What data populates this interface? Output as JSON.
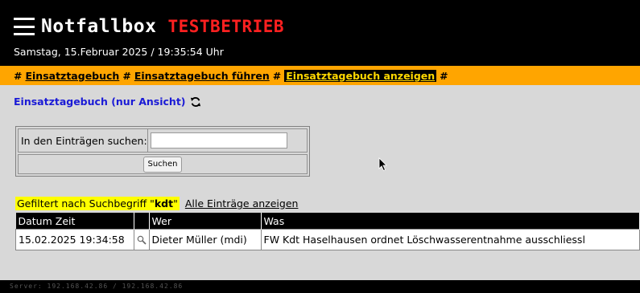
{
  "header": {
    "app_title": "Notfallbox",
    "mode_label": "TESTBETRIEB",
    "datetime": "Samstag, 15.Februar 2025 / 19:35:54 Uhr"
  },
  "breadcrumb": {
    "separator": "#",
    "items": [
      {
        "label": "Einsatztagebuch"
      },
      {
        "label": "Einsatztagebuch führen"
      },
      {
        "label": "Einsatztagebuch anzeigen"
      }
    ]
  },
  "page": {
    "heading": "Einsatztagebuch (nur Ansicht)"
  },
  "search": {
    "label": "In den Einträgen suchen:",
    "value": "",
    "button_label": "Suchen"
  },
  "filter": {
    "prefix": "Gefiltert nach Suchbegriff \"",
    "term": "kdt",
    "suffix": "\"",
    "show_all_label": "Alle Einträge anzeigen"
  },
  "table": {
    "columns": [
      "Datum Zeit",
      "",
      "Wer",
      "Was"
    ],
    "rows": [
      {
        "datetime": "15.02.2025 19:34:58",
        "who": "Dieter Müller (mdi)",
        "what": "FW Kdt Haselhausen ordnet Löschwasserentnahme ausschliessl"
      }
    ]
  },
  "footer": {
    "server": "Server: 192.168.42.86 / 192.168.42.86"
  },
  "colors": {
    "header_bg": "#000000",
    "mode_red": "#ff2020",
    "breadcrumb_bg": "#ffa500",
    "heading_blue": "#1a1ad6",
    "filter_highlight": "#ffff00"
  },
  "icons": [
    "hamburger-icon",
    "refresh-icon",
    "magnifier-icon",
    "mouse-cursor-icon"
  ]
}
